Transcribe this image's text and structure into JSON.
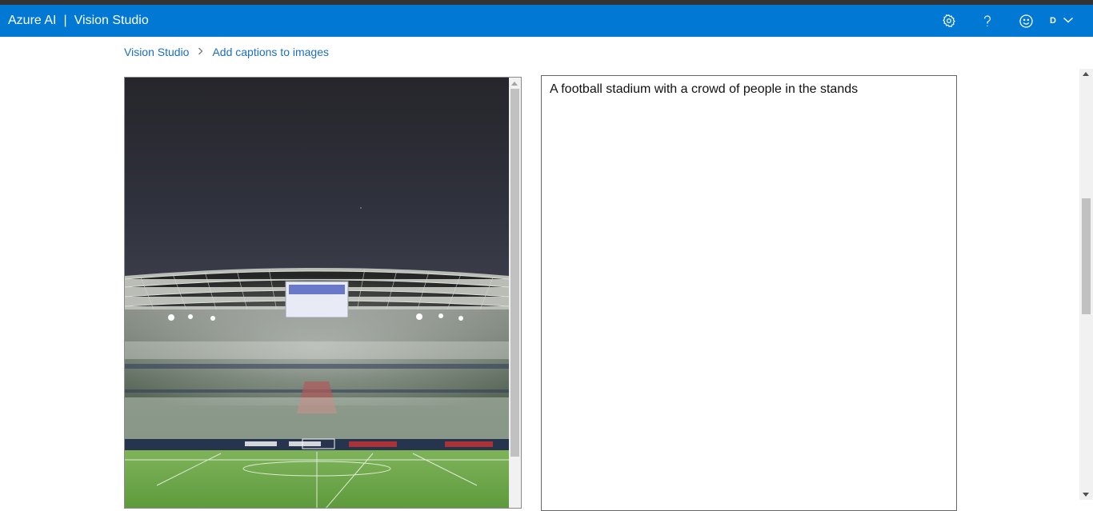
{
  "header": {
    "brand": "Azure AI",
    "separator": "|",
    "product": "Vision Studio",
    "icons": [
      "settings-gear-icon",
      "help-question-icon",
      "feedback-smiley-icon"
    ],
    "account_initial": "D"
  },
  "breadcrumb": {
    "root": "Vision Studio",
    "current": "Add captions to images"
  },
  "image": {
    "description_icon": "stadium-photo"
  },
  "caption": {
    "text": "A football stadium with a crowd of people in the stands"
  },
  "colors": {
    "header_bg": "#0078d4",
    "link": "#1b6ec2",
    "top_strip": "#333333"
  }
}
